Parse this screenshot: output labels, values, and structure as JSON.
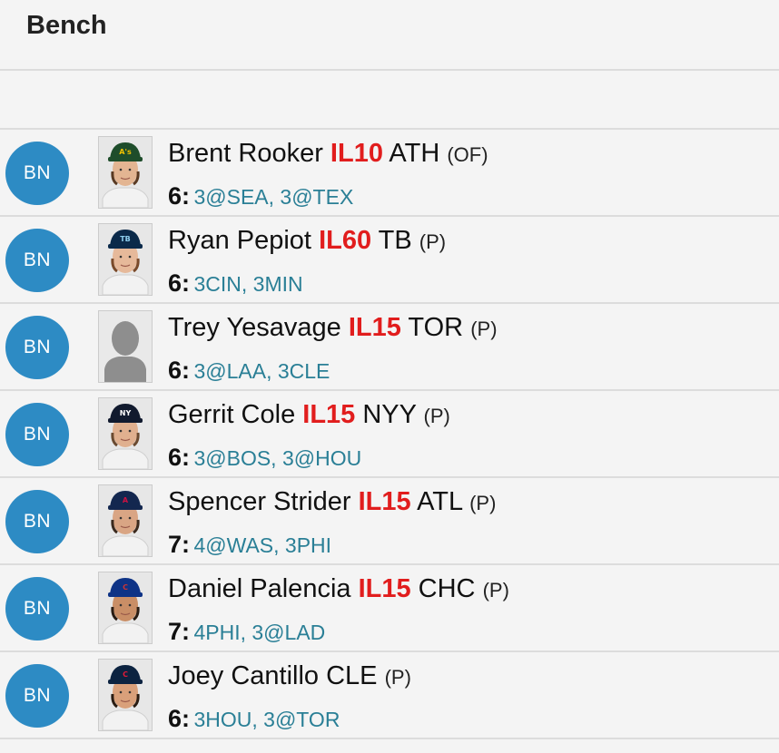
{
  "header": {
    "title": "Bench"
  },
  "colors": {
    "badge": "#2d8bc4",
    "injury": "#e11d1d",
    "schedule": "#2a7f96"
  },
  "players": [
    {
      "badge": "BN",
      "name": "Brent Rooker",
      "status": "IL10",
      "team": "ATH",
      "position": "(OF)",
      "games": "6:",
      "schedule": "3@SEA, 3@TEX",
      "photo": {
        "type": "player",
        "cap": "#1e4d2b",
        "logo": "A's",
        "logoColor": "#f2c200",
        "skin": "#e3b592",
        "hair": "#5a3a22"
      }
    },
    {
      "badge": "BN",
      "name": "Ryan Pepiot",
      "status": "IL60",
      "team": "TB",
      "position": "(P)",
      "games": "6:",
      "schedule": "3CIN, 3MIN",
      "photo": {
        "type": "player",
        "cap": "#0b2a4a",
        "logo": "TB",
        "logoColor": "#8fd0f0",
        "skin": "#e6b99a",
        "hair": "#7a4a2a"
      }
    },
    {
      "badge": "BN",
      "name": "Trey Yesavage",
      "status": "IL15",
      "team": "TOR",
      "position": "(P)",
      "games": "6:",
      "schedule": "3@LAA, 3CLE",
      "photo": {
        "type": "placeholder"
      }
    },
    {
      "badge": "BN",
      "name": "Gerrit Cole",
      "status": "IL15",
      "team": "NYY",
      "position": "(P)",
      "games": "6:",
      "schedule": "3@BOS, 3@HOU",
      "photo": {
        "type": "player",
        "cap": "#111a2e",
        "logo": "NY",
        "logoColor": "#ffffff",
        "skin": "#e0b08f",
        "hair": "#6a4a30"
      }
    },
    {
      "badge": "BN",
      "name": "Spencer Strider",
      "status": "IL15",
      "team": "ATL",
      "position": "(P)",
      "games": "7:",
      "schedule": "4@WAS, 3PHI",
      "photo": {
        "type": "player",
        "cap": "#13274f",
        "logo": "A",
        "logoColor": "#ce1141",
        "skin": "#d9a584",
        "hair": "#3b2a1e"
      }
    },
    {
      "badge": "BN",
      "name": "Daniel Palencia",
      "status": "IL15",
      "team": "CHC",
      "position": "(P)",
      "games": "7:",
      "schedule": "4PHI, 3@LAD",
      "photo": {
        "type": "player",
        "cap": "#0e3386",
        "logo": "C",
        "logoColor": "#cc3433",
        "skin": "#c98e66",
        "hair": "#2a1c12"
      }
    },
    {
      "badge": "BN",
      "name": "Joey Cantillo",
      "status": "",
      "team": "CLE",
      "position": "(P)",
      "games": "6:",
      "schedule": "3HOU, 3@TOR",
      "photo": {
        "type": "player",
        "cap": "#0c2340",
        "logo": "C",
        "logoColor": "#e31937",
        "skin": "#d9a07a",
        "hair": "#2a1c12"
      }
    }
  ]
}
